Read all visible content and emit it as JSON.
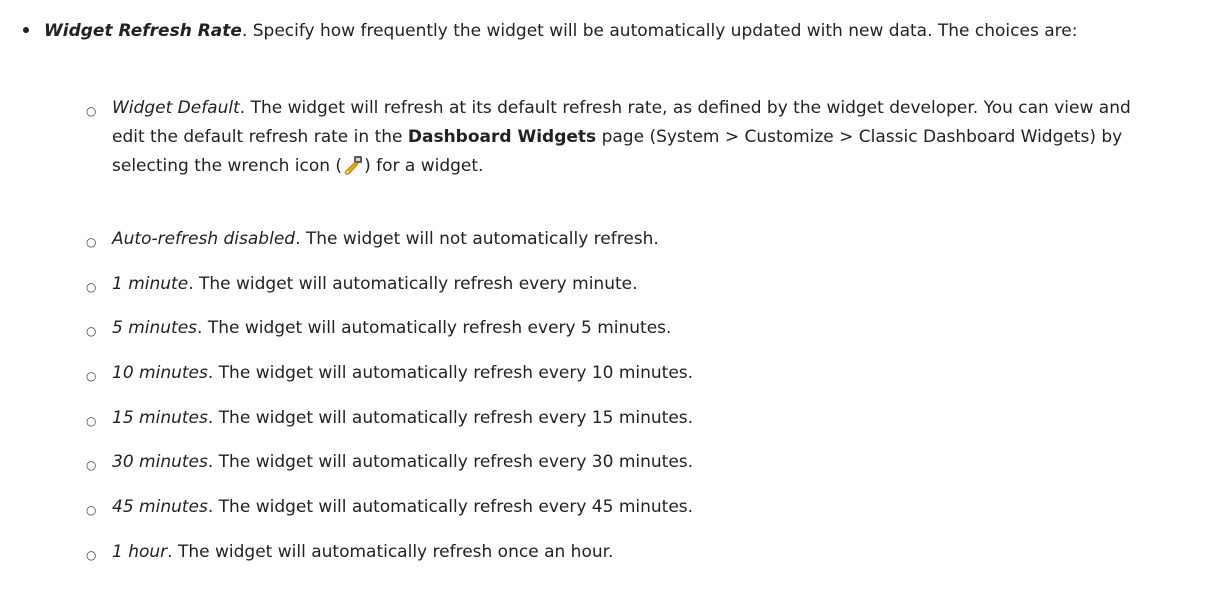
{
  "bullet": {
    "term": "Widget Refresh Rate",
    "text": ". Specify how frequently the widget will be automatically updated with new data. The choices are:"
  },
  "options": [
    {
      "term": "Widget Default",
      "pre": ". The widget will refresh at its default refresh rate, as defined by the widget developer. You can view and edit the default refresh rate in the ",
      "strong": "Dashboard Widgets",
      "mid": " page (System > Customize > Classic Dashboard Widgets) by selecting the wrench icon (",
      "icon": "wrench-icon",
      "post": ") for a widget."
    },
    {
      "term": "Auto-refresh disabled",
      "text": ". The widget will not automatically refresh."
    },
    {
      "term": "1 minute",
      "text": ". The widget will automatically refresh every minute."
    },
    {
      "term": "5 minutes",
      "text": ". The widget will automatically refresh every 5 minutes."
    },
    {
      "term": "10 minutes",
      "text": ". The widget will automatically refresh every 10 minutes."
    },
    {
      "term": "15 minutes",
      "text": ". The widget will automatically refresh every 15 minutes."
    },
    {
      "term": "30 minutes",
      "text": ". The widget will automatically refresh every 30 minutes."
    },
    {
      "term": "45 minutes",
      "text": ". The widget will automatically refresh every 45 minutes."
    },
    {
      "term": "1 hour",
      "text": ". The widget will automatically refresh once an hour."
    }
  ],
  "sub_marker": "○",
  "colors": {
    "text": "#222222",
    "wrench_gold": "#e8a317",
    "wrench_gray": "#5a5a5a"
  }
}
